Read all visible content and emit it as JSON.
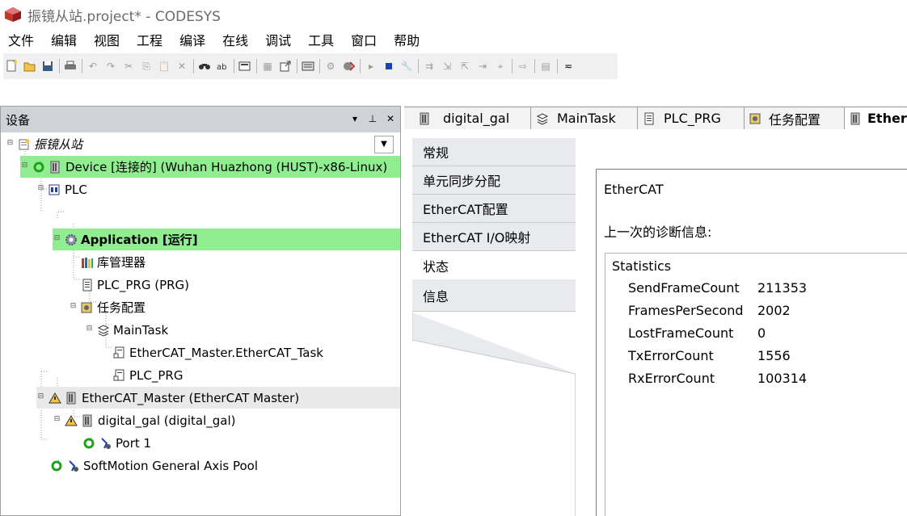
{
  "window": {
    "title": "振镜从站.project* - CODESYS"
  },
  "menu": [
    "文件",
    "编辑",
    "视图",
    "工程",
    "编译",
    "在线",
    "调试",
    "工具",
    "窗口",
    "帮助"
  ],
  "device_pane": {
    "title": "设备",
    "tree": [
      {
        "label": "振镜从站",
        "icon": "project-icon",
        "style": "italic"
      },
      {
        "label": "Device [连接的] (Wuhan Huazhong (HUST)-x86-Linux)",
        "icon": "device-icon",
        "highlight": true
      },
      {
        "label": "PLC",
        "icon": "plc-icon"
      },
      {
        "label": "Application [运行]",
        "icon": "application-gear-icon",
        "highlight": true,
        "style": "bold"
      },
      {
        "label": "库管理器",
        "icon": "library-manager-icon"
      },
      {
        "label": "PLC_PRG (PRG)",
        "icon": "program-icon"
      },
      {
        "label": "任务配置",
        "icon": "task-config-icon"
      },
      {
        "label": "MainTask",
        "icon": "task-icon"
      },
      {
        "label": "EtherCAT_Master.EtherCAT_Task",
        "icon": "task-call-icon"
      },
      {
        "label": "PLC_PRG",
        "icon": "task-call-icon"
      },
      {
        "label": "EtherCAT_Master (EtherCAT Master)",
        "icon": "ethercat-master-icon",
        "selected": true
      },
      {
        "label": "digital_gal (digital_gal)",
        "icon": "ethercat-slave-icon"
      },
      {
        "label": "Port 1",
        "icon": "port-icon"
      },
      {
        "label": "SoftMotion General Axis Pool",
        "icon": "axis-pool-icon"
      }
    ]
  },
  "editor": {
    "tabs": [
      "digital_gal",
      "MainTask",
      "PLC_PRG",
      "任务配置",
      "EtherCAT_Master"
    ],
    "active_tab": "EtherCAT_Master",
    "side_tabs": [
      "常规",
      "单元同步分配",
      "EtherCAT配置",
      "EtherCAT I/O映射",
      "状态",
      "信息"
    ],
    "active_side_tab": "状态",
    "content": {
      "heading": "EtherCAT",
      "diag_label": "上一次的诊断信息:",
      "statistics_title": "Statistics",
      "stats": [
        {
          "key": "SendFrameCount",
          "value": "211353"
        },
        {
          "key": "FramesPerSecond",
          "value": "2002"
        },
        {
          "key": "LostFrameCount",
          "value": "0"
        },
        {
          "key": "TxErrorCount",
          "value": "1556"
        },
        {
          "key": "RxErrorCount",
          "value": "100314"
        }
      ]
    }
  },
  "colors": {
    "highlight_green": "#90ee90",
    "pane_header": "#cfd3d9",
    "tab_strip": "#e7eaee"
  }
}
